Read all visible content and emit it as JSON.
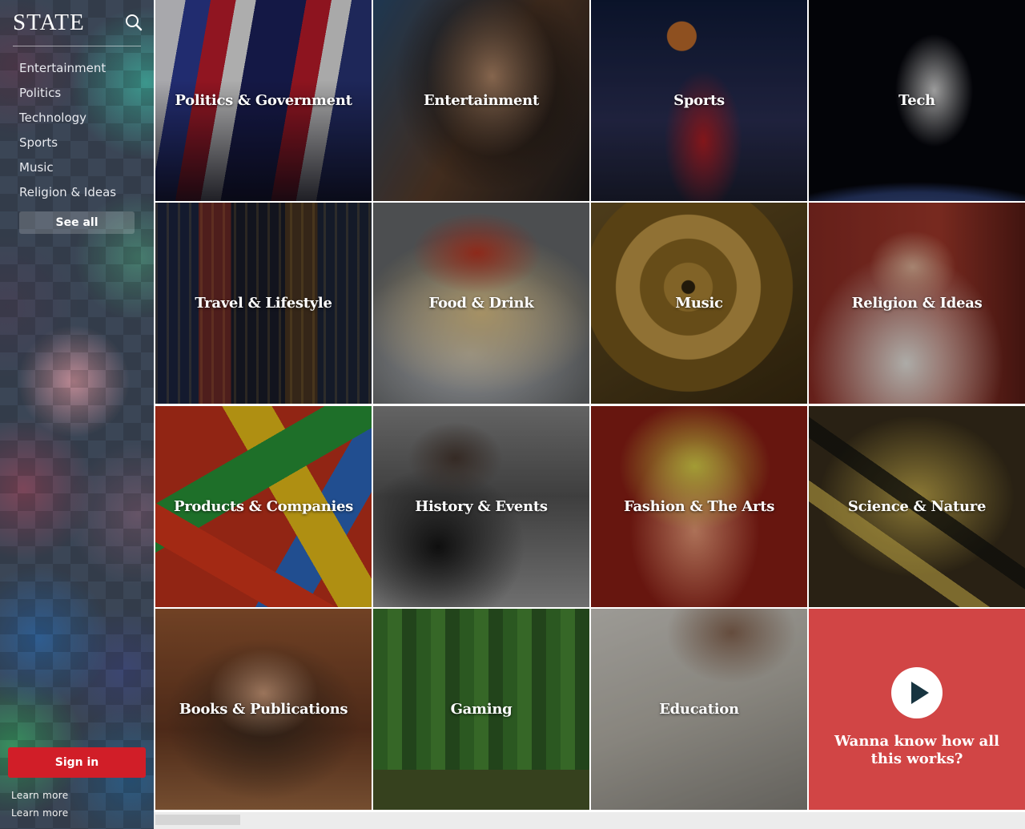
{
  "brand": {
    "logo": "STATE"
  },
  "sidebar": {
    "nav": [
      "Entertainment",
      "Politics",
      "Technology",
      "Sports",
      "Music",
      "Religion & Ideas"
    ],
    "see_all": "See all",
    "sign_in": "Sign in",
    "learn_more": [
      "Learn more",
      "Learn more"
    ]
  },
  "tiles": [
    "Politics & Government",
    "Entertainment",
    "Sports",
    "Tech",
    "Travel & Lifestyle",
    "Food & Drink",
    "Music",
    "Religion & Ideas",
    "Products & Companies",
    "History & Events",
    "Fashion & The Arts",
    "Science & Nature",
    "Books & Publications",
    "Gaming",
    "Education"
  ],
  "video": {
    "text": "Wanna know how all this works?"
  },
  "colors": {
    "accent_red": "#d11e28",
    "video_tile": "#d14545"
  },
  "icons": {
    "search": "search-icon",
    "play": "play-icon"
  }
}
